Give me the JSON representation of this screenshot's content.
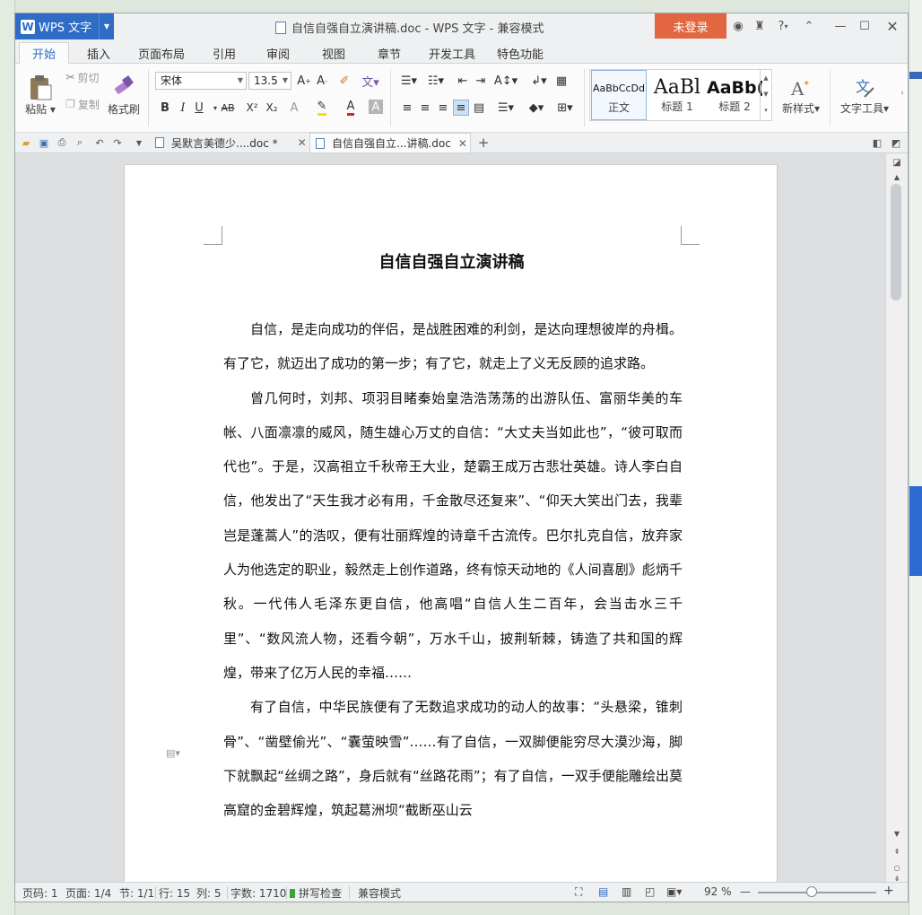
{
  "app": {
    "name": "WPS 文字",
    "window_title": "自信自强自立演讲稿.doc - WPS 文字 - 兼容模式",
    "login_label": "未登录",
    "help_label": "?"
  },
  "ribbon_tabs": [
    "开始",
    "插入",
    "页面布局",
    "引用",
    "审阅",
    "视图",
    "章节",
    "开发工具",
    "特色功能"
  ],
  "ribbon": {
    "paste": "粘贴",
    "cut": "剪切",
    "copy": "复制",
    "format_painter": "格式刷",
    "font_name": "宋体",
    "font_size": "13.5",
    "bold": "B",
    "italic": "I",
    "underline": "U",
    "strike": "AB",
    "superscript": "X²",
    "subscript": "X₂",
    "styles": [
      {
        "preview": "AaBbCcDd",
        "name": "正文"
      },
      {
        "preview": "AaBl",
        "name": "标题 1"
      },
      {
        "preview": "AaBb(",
        "name": "标题 2"
      }
    ],
    "new_style": "新样式",
    "text_tools": "文字工具"
  },
  "doc_tabs": [
    {
      "label": "吴默言美德少....doc *"
    },
    {
      "label": "自信自强自立...讲稿.doc"
    }
  ],
  "document": {
    "title": "自信自强自立演讲稿",
    "paragraphs": [
      "自信，是走向成功的伴侣，是战胜困难的利剑，是达向理想彼岸的舟楫。有了它，就迈出了成功的第一步；有了它，就走上了义无反顾的追求路。",
      "曾几何时，刘邦、项羽目睹秦始皇浩浩荡荡的出游队伍、富丽华美的车帐、八面凛凛的威风，随生雄心万丈的自信：“大丈夫当如此也”，“彼可取而代也”。于是，汉高祖立千秋帝王大业，楚霸王成万古悲壮英雄。诗人李白自信，他发出了“天生我才必有用，千金散尽还复来”、“仰天大笑出门去，我辈岂是蓬蒿人”的浩叹，便有壮丽辉煌的诗章千古流传。巴尔扎克自信，放弃家人为他选定的职业，毅然走上创作道路，终有惊天动地的《人间喜剧》彪炳千秋。一代伟人毛泽东更自信，他高唱“自信人生二百年，会当击水三千里”、“数风流人物，还看今朝”，万水千山，披荆斩棘，铸造了共和国的辉煌，带来了亿万人民的幸福……",
      "有了自信，中华民族便有了无数追求成功的动人的故事：“头悬梁，锥刺骨”、“凿壁偷光”、“囊萤映雪”……有了自信，一双脚便能穷尽大漠沙海，脚下就飘起“丝绸之路”，身后就有“丝路花雨”；有了自信，一双手便能雕绘出莫高窟的金碧辉煌，筑起葛洲坝“截断巫山云"
    ]
  },
  "status_bar": {
    "page_num": "页码: 1",
    "pages": "页面: 1/4",
    "section": "节: 1/1",
    "row": "行: 15",
    "col": "列: 5",
    "word_count": "字数: 1710",
    "spell_check": "拼写检查",
    "compat_mode": "兼容模式",
    "zoom": "92 %"
  },
  "colors": {
    "accent": "#2e6cc5",
    "login": "#e2663f"
  }
}
